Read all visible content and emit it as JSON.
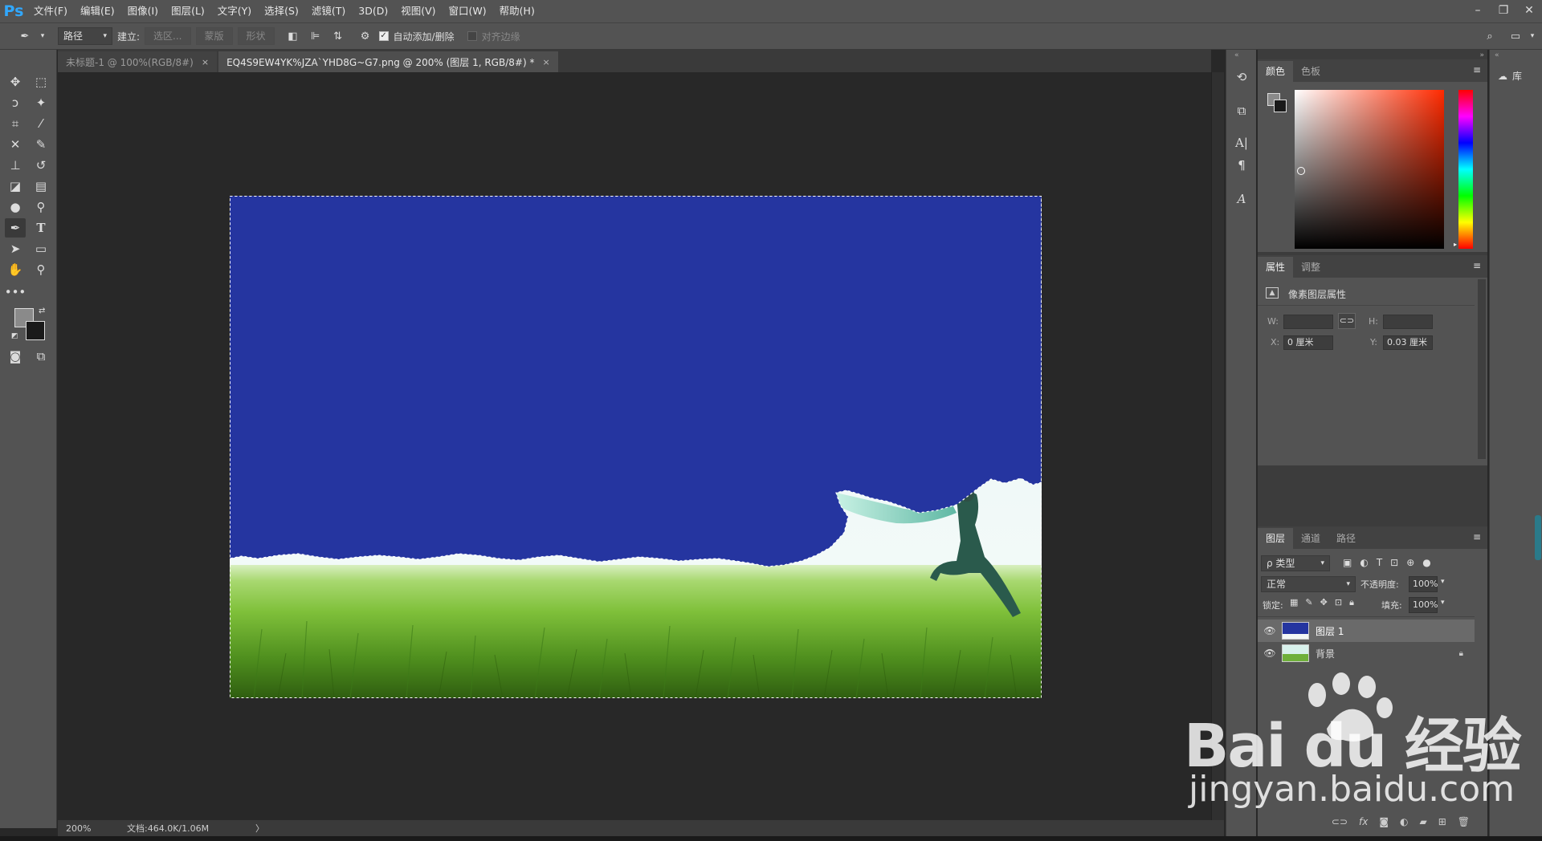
{
  "app": {
    "logo": "Ps"
  },
  "menu": [
    "文件(F)",
    "编辑(E)",
    "图像(I)",
    "图层(L)",
    "文字(Y)",
    "选择(S)",
    "滤镜(T)",
    "3D(D)",
    "视图(V)",
    "窗口(W)",
    "帮助(H)"
  ],
  "window_controls": {
    "minimize": "–",
    "restore": "❐",
    "close": "✕"
  },
  "options": {
    "mode_select": "路径",
    "make_label": "建立:",
    "selection_btn": "选区...",
    "mask_btn": "蒙版",
    "shape_btn": "形状",
    "auto_add_label": "自动添加/删除",
    "auto_add_checked": true,
    "align_edges_label": "对齐边缘",
    "align_edges_checked": false
  },
  "tabs": [
    {
      "label": "未标题-1 @ 100%(RGB/8#)",
      "active": false,
      "close": "×"
    },
    {
      "label": "EQ4S9EW4YK%JZA`YHD8G~G7.png @ 200% (图层 1, RGB/8#) *",
      "active": true,
      "close": "×"
    }
  ],
  "status": {
    "zoom": "200%",
    "doc": "文档:464.0K/1.06M",
    "arrow": "〉"
  },
  "color_panel": {
    "tabs": [
      "颜色",
      "色板"
    ],
    "active_tab": 0,
    "hue_color": "#ff2a00",
    "foreground": "#8a8a8a",
    "background": "#1a1a1a"
  },
  "properties_panel": {
    "tabs": [
      "属性",
      "调整"
    ],
    "title": "像素图层属性",
    "w_label": "W:",
    "w_value": "",
    "h_label": "H:",
    "h_value": "",
    "x_label": "X:",
    "x_value": "0 厘米",
    "y_label": "Y:",
    "y_value": "0.03 厘米"
  },
  "layers_panel": {
    "tabs": [
      "图层",
      "通道",
      "路径"
    ],
    "filter_label": "ρ 类型",
    "blend_mode": "正常",
    "opacity_label": "不透明度:",
    "opacity_value": "100%",
    "lock_label": "锁定:",
    "fill_label": "填充:",
    "fill_value": "100%",
    "layers": [
      {
        "name": "图层 1",
        "selected": true,
        "locked": false
      },
      {
        "name": "背景",
        "selected": false,
        "locked": true
      }
    ]
  },
  "far_right": {
    "libraries_label": "库"
  },
  "watermark": {
    "line1": "Bai du 经验",
    "line2": "jingyan.baidu.com"
  },
  "colors": {
    "selection_fill": "#2535a0",
    "ui_bg": "#535353",
    "canvas_bg": "#282828"
  }
}
